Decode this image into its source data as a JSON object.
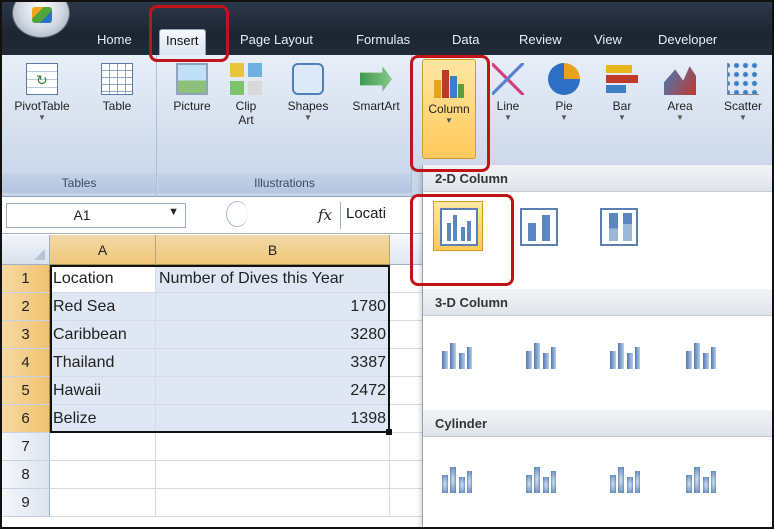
{
  "ribbon_tabs": [
    "Home",
    "Insert",
    "Page Layout",
    "Formulas",
    "Data",
    "Review",
    "View",
    "Developer"
  ],
  "active_tab": "Insert",
  "groups": {
    "tables": {
      "label": "Tables",
      "buttons": [
        {
          "label": "PivotTable",
          "icon": "pivot-table-icon",
          "has_dropdown": true
        },
        {
          "label": "Table",
          "icon": "table-icon",
          "has_dropdown": false
        }
      ]
    },
    "illustrations": {
      "label": "Illustrations",
      "buttons": [
        {
          "label": "Picture",
          "icon": "picture-icon",
          "has_dropdown": false
        },
        {
          "label": "Clip",
          "label2": "Art",
          "icon": "clip-art-icon",
          "has_dropdown": false
        },
        {
          "label": "Shapes",
          "icon": "shapes-icon",
          "has_dropdown": true
        },
        {
          "label": "SmartArt",
          "icon": "smartart-icon",
          "has_dropdown": false
        }
      ]
    },
    "charts": {
      "buttons": [
        {
          "label": "Column",
          "icon": "column-chart-icon",
          "pressed": true
        },
        {
          "label": "Line",
          "icon": "line-chart-icon"
        },
        {
          "label": "Pie",
          "icon": "pie-chart-icon"
        },
        {
          "label": "Bar",
          "icon": "bar-chart-icon"
        },
        {
          "label": "Area",
          "icon": "area-chart-icon"
        },
        {
          "label": "Scatter",
          "icon": "scatter-chart-icon"
        }
      ]
    }
  },
  "formula_bar": {
    "name_box": "A1",
    "fx_symbol": "fx",
    "value_visible": "Locati"
  },
  "sheet": {
    "columns": [
      "A",
      "B"
    ],
    "rows": [
      {
        "num": "1",
        "a": "Location",
        "b": "Number of Dives this Year"
      },
      {
        "num": "2",
        "a": "Red Sea",
        "b": "1780"
      },
      {
        "num": "3",
        "a": "Caribbean",
        "b": "3280"
      },
      {
        "num": "4",
        "a": "Thailand",
        "b": "3387"
      },
      {
        "num": "5",
        "a": "Hawaii",
        "b": "2472"
      },
      {
        "num": "6",
        "a": "Belize",
        "b": "1398"
      },
      {
        "num": "7",
        "a": "",
        "b": ""
      },
      {
        "num": "8",
        "a": "",
        "b": ""
      },
      {
        "num": "9",
        "a": "",
        "b": ""
      }
    ]
  },
  "gallery": {
    "sections": [
      {
        "title": "2-D Column",
        "items": [
          "clustered-column",
          "stacked-column",
          "100-stacked-column"
        ],
        "selected_index": 0
      },
      {
        "title": "3-D Column",
        "items": [
          "3d-clustered-column",
          "3d-stacked-column",
          "3d-100-stacked-column",
          "3d-column"
        ]
      },
      {
        "title": "Cylinder",
        "items": [
          "clustered-cylinder",
          "stacked-cylinder",
          "100-stacked-cylinder",
          "3d-cylinder"
        ]
      }
    ]
  },
  "highlight_color": "#c0141a",
  "selection_color": "#ffc85a"
}
